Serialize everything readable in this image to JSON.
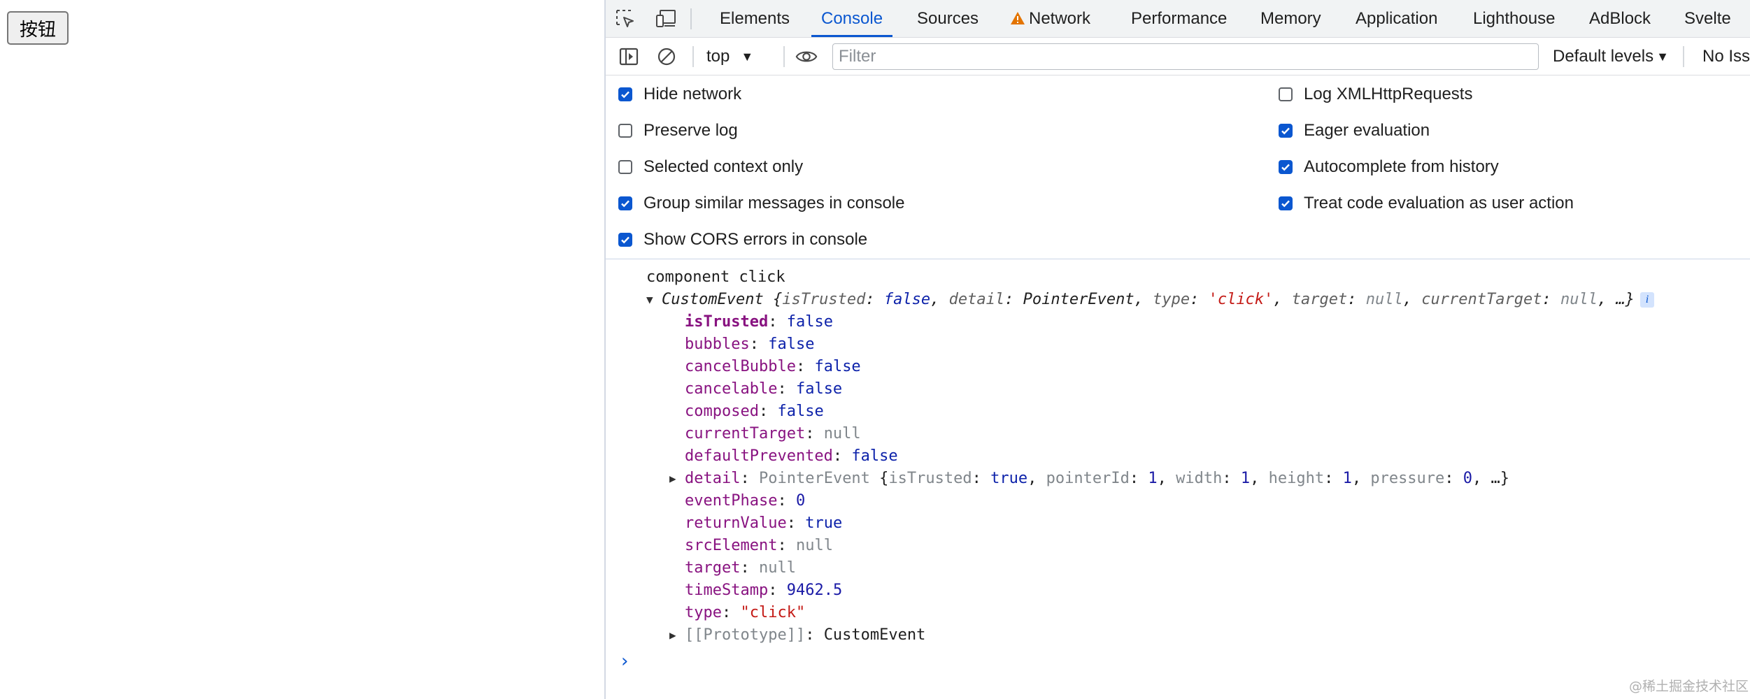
{
  "page": {
    "button_label": "按钮"
  },
  "devtools": {
    "tabs": [
      {
        "label": "Elements"
      },
      {
        "label": "Console"
      },
      {
        "label": "Sources"
      },
      {
        "label": "Network"
      },
      {
        "label": "Performance"
      },
      {
        "label": "Memory"
      },
      {
        "label": "Application"
      },
      {
        "label": "Lighthouse"
      },
      {
        "label": "AdBlock"
      },
      {
        "label": "Svelte"
      }
    ],
    "active_tab": "Console",
    "toolbar": {
      "context": "top",
      "filter_placeholder": "Filter",
      "levels": "Default levels",
      "issues": "No Iss"
    },
    "settings": {
      "left": [
        {
          "label": "Hide network",
          "checked": true
        },
        {
          "label": "Preserve log",
          "checked": false
        },
        {
          "label": "Selected context only",
          "checked": false
        },
        {
          "label": "Group similar messages in console",
          "checked": true
        },
        {
          "label": "Show CORS errors in console",
          "checked": true
        }
      ],
      "right": [
        {
          "label": "Log XMLHttpRequests",
          "checked": false
        },
        {
          "label": "Eager evaluation",
          "checked": true
        },
        {
          "label": "Autocomplete from history",
          "checked": true
        },
        {
          "label": "Treat code evaluation as user action",
          "checked": true
        }
      ]
    },
    "console": {
      "log_message": "component click",
      "object": {
        "class": "CustomEvent",
        "preview": [
          {
            "key": "isTrusted",
            "value": "false",
            "type": "kw"
          },
          {
            "key": "detail",
            "value": "PointerEvent",
            "type": "obj"
          },
          {
            "key": "type",
            "value": "'click'",
            "type": "str"
          },
          {
            "key": "target",
            "value": "null",
            "type": "null"
          },
          {
            "key": "currentTarget",
            "value": "null",
            "type": "null"
          }
        ],
        "preview_ellipsis": "…}",
        "info_badge": "i",
        "properties": [
          {
            "key": "isTrusted",
            "value": "false",
            "type": "kw",
            "own": true
          },
          {
            "key": "bubbles",
            "value": "false",
            "type": "kw"
          },
          {
            "key": "cancelBubble",
            "value": "false",
            "type": "kw"
          },
          {
            "key": "cancelable",
            "value": "false",
            "type": "kw"
          },
          {
            "key": "composed",
            "value": "false",
            "type": "kw"
          },
          {
            "key": "currentTarget",
            "value": "null",
            "type": "null"
          },
          {
            "key": "defaultPrevented",
            "value": "false",
            "type": "kw"
          },
          {
            "key": "detail",
            "value": "PointerEvent",
            "type": "expandable",
            "preview": [
              {
                "key": "isTrusted",
                "value": "true"
              },
              {
                "key": "pointerId",
                "value": "1"
              },
              {
                "key": "width",
                "value": "1"
              },
              {
                "key": "height",
                "value": "1"
              },
              {
                "key": "pressure",
                "value": "0"
              }
            ],
            "ellipsis": "…}"
          },
          {
            "key": "eventPhase",
            "value": "0",
            "type": "num"
          },
          {
            "key": "returnValue",
            "value": "true",
            "type": "kw"
          },
          {
            "key": "srcElement",
            "value": "null",
            "type": "null"
          },
          {
            "key": "target",
            "value": "null",
            "type": "null"
          },
          {
            "key": "timeStamp",
            "value": "9462.5",
            "type": "num"
          },
          {
            "key": "type",
            "value": "\"click\"",
            "type": "str"
          },
          {
            "key": "[[Prototype]]",
            "value": "CustomEvent",
            "type": "proto"
          }
        ]
      },
      "prompt": "›"
    }
  },
  "watermark": "@稀土掘金技术社区",
  "colors": {
    "accent": "#0b57d0",
    "key": "#881280",
    "keyword": "#0d22aa",
    "string": "#c41a16",
    "null": "#80868b"
  }
}
